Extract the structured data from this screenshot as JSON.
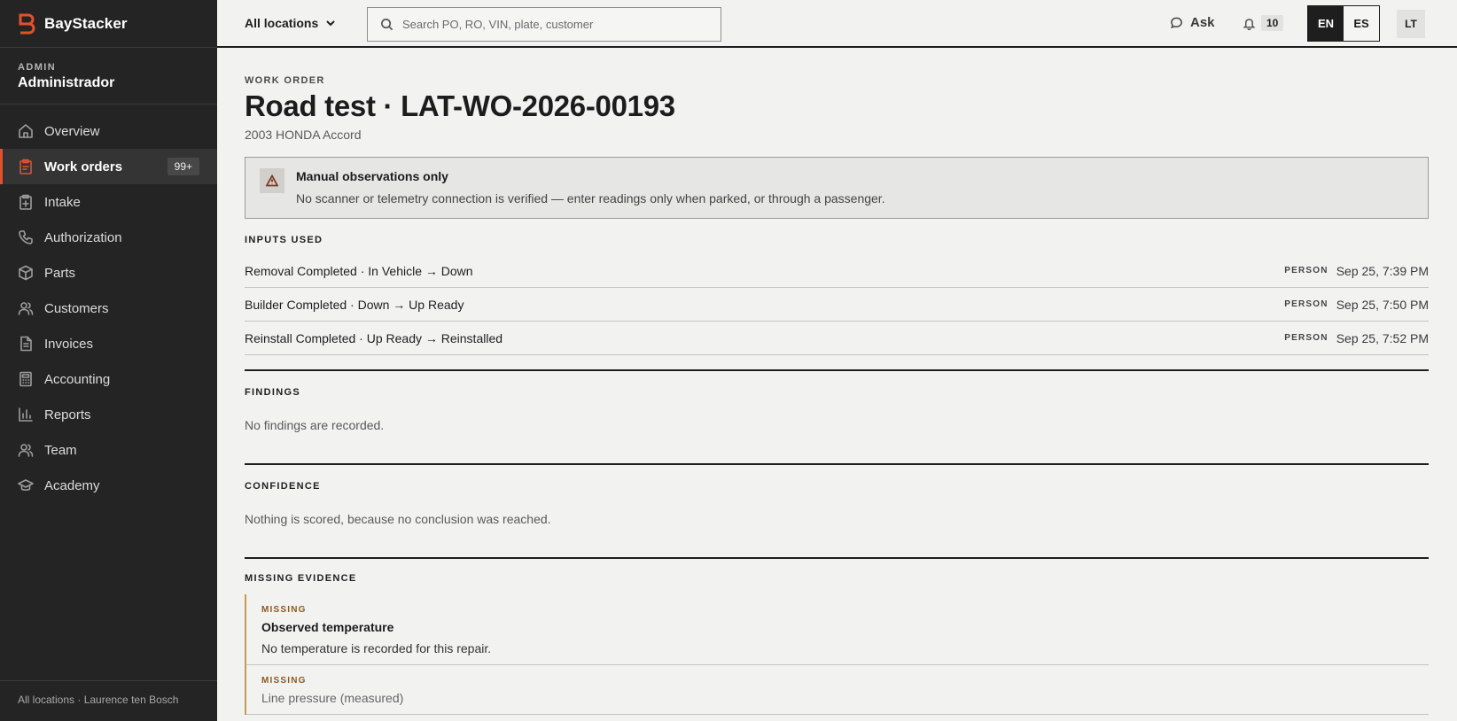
{
  "brand": {
    "name": "BayStacker",
    "accent": "#e0522b"
  },
  "account": {
    "role_tag": "ADMIN",
    "role_name": "Administrador"
  },
  "sidebar": {
    "items": [
      {
        "label": "Overview",
        "icon": "home-icon"
      },
      {
        "label": "Work orders",
        "icon": "clipboard-icon",
        "badge": "99+",
        "active": true
      },
      {
        "label": "Intake",
        "icon": "clipboard-plus-icon"
      },
      {
        "label": "Authorization",
        "icon": "phone-icon"
      },
      {
        "label": "Parts",
        "icon": "box-icon"
      },
      {
        "label": "Customers",
        "icon": "users-icon"
      },
      {
        "label": "Invoices",
        "icon": "file-icon"
      },
      {
        "label": "Accounting",
        "icon": "calculator-icon"
      },
      {
        "label": "Reports",
        "icon": "bar-chart-icon"
      },
      {
        "label": "Team",
        "icon": "team-icon"
      },
      {
        "label": "Academy",
        "icon": "graduation-cap-icon"
      }
    ],
    "footer": "All locations · Laurence ten Bosch"
  },
  "topbar": {
    "location": "All locations",
    "search_placeholder": "Search PO, RO, VIN, plate, customer",
    "ask_label": "Ask",
    "notification_count": "10",
    "languages": [
      "EN",
      "ES"
    ],
    "active_language": "EN",
    "avatar_initials": "LT"
  },
  "page": {
    "eyebrow": "WORK ORDER",
    "title": "Road test · LAT-WO-2026-00193",
    "vehicle": "2003 HONDA Accord",
    "callout": {
      "title": "Manual observations only",
      "body": "No scanner or telemetry connection is verified — enter readings only when parked, or through a passenger."
    },
    "inputs_heading": "INPUTS USED",
    "inputs": [
      {
        "label": "Removal Completed · In Vehicle → Down",
        "source": "PERSON",
        "time": "Sep 25, 7:39 PM"
      },
      {
        "label": "Builder Completed · Down → Up Ready",
        "source": "PERSON",
        "time": "Sep 25, 7:50 PM"
      },
      {
        "label": "Reinstall Completed · Up Ready → Reinstalled",
        "source": "PERSON",
        "time": "Sep 25, 7:52 PM"
      }
    ],
    "findings_heading": "FINDINGS",
    "findings_text": "No findings are recorded.",
    "confidence_heading": "CONFIDENCE",
    "confidence_text": "Nothing is scored, because no conclusion was reached.",
    "missing_heading": "MISSING EVIDENCE",
    "missing": [
      {
        "tag": "MISSING",
        "title": "Observed temperature",
        "desc": "No temperature is recorded for this repair."
      },
      {
        "tag": "MISSING",
        "title": "Line pressure (measured)",
        "desc": ""
      }
    ]
  }
}
